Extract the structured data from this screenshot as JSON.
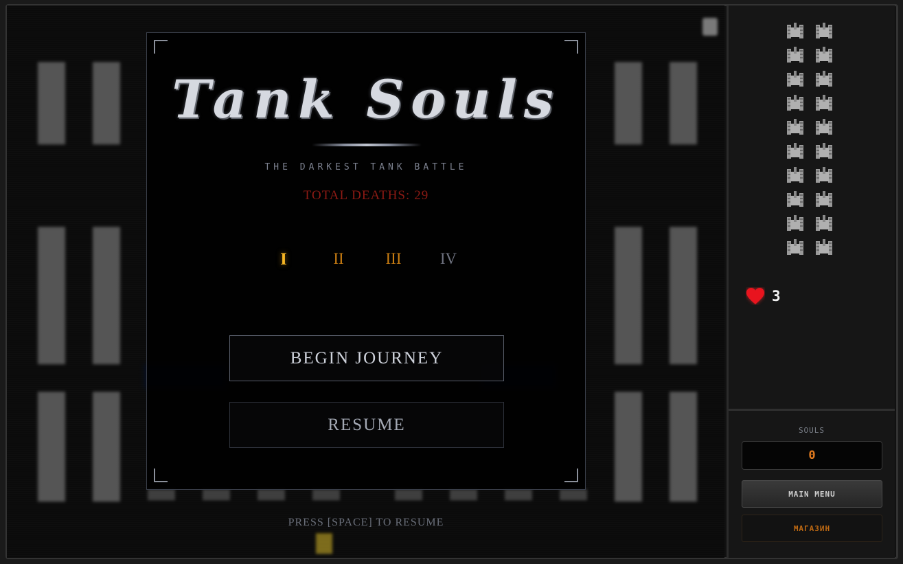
{
  "modal": {
    "title": "Tank Souls",
    "subtitle": "THE DARKEST TANK BATTLE",
    "deaths_label": "TOTAL DEATHS:",
    "deaths_value": "29",
    "levels": [
      {
        "label": "I",
        "state": "active"
      },
      {
        "label": "II",
        "state": "unlocked"
      },
      {
        "label": "III",
        "state": "unlocked"
      },
      {
        "label": "IV",
        "state": "locked"
      }
    ],
    "begin_label": "BEGIN JOURNEY",
    "resume_label": "RESUME"
  },
  "hint": "PRESS [SPACE] TO RESUME",
  "sidebar": {
    "enemy_icons_remaining": 20,
    "lives": "3",
    "souls_label": "SOULS",
    "souls_value": "0",
    "main_menu_label": "MAIN MENU",
    "shop_label": "МАГАЗИН"
  },
  "colors": {
    "accent_gold": "#f5b524",
    "level_orange": "#c97d12",
    "deaths_red": "#8c1a14",
    "souls_orange": "#e07a1f",
    "heart_red": "#e8141e"
  },
  "icons": {
    "enemy": "enemy-tank-icon",
    "lives": "heart-icon"
  }
}
